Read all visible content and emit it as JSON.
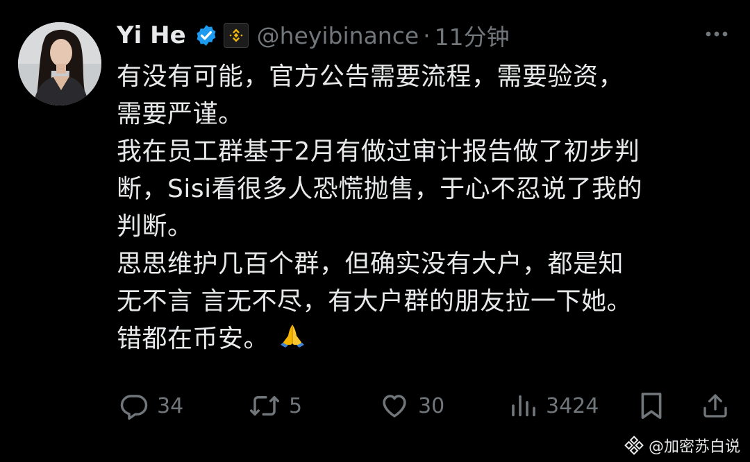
{
  "tweet": {
    "author": {
      "name": "Yi He",
      "handle": "@heyibinance",
      "separator": "·",
      "time": "11分钟"
    },
    "body_lines": [
      "有没有可能，官方公告需要流程，需要验资，",
      "需要严谨。",
      "我在员工群基于2月有做过审计报告做了初步判",
      "断，Sisi看很多人恐慌抛售，于心不忍说了我的",
      "判断。",
      "思思维护几百个群，但确实没有大户，都是知",
      "无不言 言无不尽，有大户群的朋友拉一下她。",
      "错都在币安。"
    ],
    "emoji": "🙏",
    "metrics": {
      "replies": "34",
      "reposts": "5",
      "likes": "30",
      "views": "3424"
    }
  },
  "watermark": {
    "text": "@加密苏白说"
  },
  "colors": {
    "background": "#000000",
    "text_primary": "#e7e9ea",
    "text_secondary": "#71767b",
    "verified": "#1d9bf0",
    "binance": "#f0b90b"
  },
  "icons": {
    "verified": "verified-badge-icon",
    "affiliate": "binance-logo-icon",
    "more": "more-dots-icon",
    "reply": "reply-icon",
    "repost": "repost-icon",
    "like": "heart-icon",
    "views": "views-chart-icon",
    "bookmark": "bookmark-icon",
    "share": "share-icon",
    "watermark": "watermark-logo-icon"
  }
}
